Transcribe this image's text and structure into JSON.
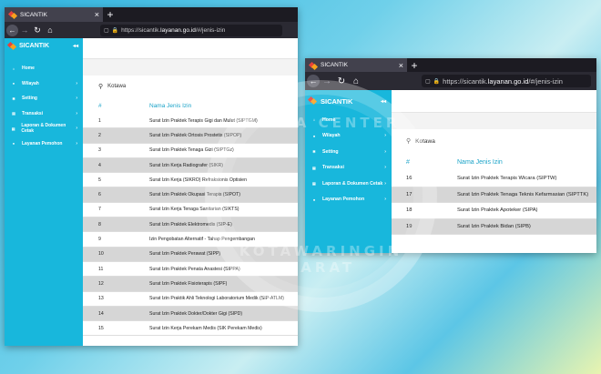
{
  "browser": {
    "tab_title": "SICANTIK",
    "close_glyph": "×",
    "newtab_glyph": "+",
    "back_glyph": "←",
    "forward_glyph": "→",
    "reload_glyph": "↻",
    "home_glyph": "⌂",
    "url_prefix": "https://sicantik.",
    "url_host": "layanan.go.id",
    "url_suffix": "/#/jenis-izin"
  },
  "sidebar": {
    "brand": "SICANTIK",
    "toggle": "◂◂",
    "items": [
      {
        "label": "Home",
        "icon": "⌂",
        "arrow": ""
      },
      {
        "label": "Wilayah",
        "icon": "●",
        "arrow": "›"
      },
      {
        "label": "Setting",
        "icon": "✱",
        "arrow": "›"
      },
      {
        "label": "Transaksi",
        "icon": "▤",
        "arrow": "›"
      },
      {
        "label": "Laporan & Dokumen Cetak",
        "icon": "▤",
        "arrow": "›"
      },
      {
        "label": "Layanan Pemohon",
        "icon": "●",
        "arrow": "›"
      }
    ]
  },
  "search": {
    "icon": "search-icon",
    "value": "Kotawa"
  },
  "table": {
    "col_no": "#",
    "col_name": "Nama Jenis Izin"
  },
  "left_rows": [
    {
      "no": "1",
      "name": "Surat Izin Praktek Terapis Gigi dan Mulut (SIPTGM)"
    },
    {
      "no": "2",
      "name": "Surat Izin Praktek Ortosis Prostetis (SIPOP)"
    },
    {
      "no": "3",
      "name": "Surat Izin Praktek Tenaga Gizi (SIPTGz)"
    },
    {
      "no": "4",
      "name": "Surat Izin Kerja Radiografer (SIKR)"
    },
    {
      "no": "5",
      "name": "Surat Izin Kerja (SIKRO) Refraksionis Optisien"
    },
    {
      "no": "6",
      "name": "Surat Izin Praktek Okupasi Terapis (SIPOT)"
    },
    {
      "no": "7",
      "name": "Surat Izin Kerja Tenaga Sanitarian (SIKTS)"
    },
    {
      "no": "8",
      "name": "Surat Izin Praktek Elektromedis (SIP-E)"
    },
    {
      "no": "9",
      "name": "Izin Pengobatan Alternatif - Tahap Pengembangan"
    },
    {
      "no": "10",
      "name": "Surat Izin Praktek Perawat (SIPP)"
    },
    {
      "no": "11",
      "name": "Surat Izin Praktek Penata Anastesi (SIPPA)"
    },
    {
      "no": "12",
      "name": "Surat Izin Praktek Fisioterapis (SIPF)"
    },
    {
      "no": "13",
      "name": "Surat Izin Praktik Ahli Teknologi Laboratorium Medik (SIP-ATLM)"
    },
    {
      "no": "14",
      "name": "Surat Izin Praktek Dokter/Dokter Gigi (SIPD)"
    },
    {
      "no": "15",
      "name": "Surat Izin Kerja Perekam Medis (SIK Perekam Medis)"
    }
  ],
  "right_rows": [
    {
      "no": "16",
      "name": "Surat Izin Praktek Terapis Wicara (SIPTW)"
    },
    {
      "no": "17",
      "name": "Surat Izin Praktek Tenaga Teknis Kefarmasian (SIPTTK)"
    },
    {
      "no": "18",
      "name": "Surat Izin Praktek Apoteker (SIPA)"
    },
    {
      "no": "19",
      "name": "Surat Izin Praktek Bidan (SIPB)"
    }
  ],
  "watermark": {
    "top": "MEDIA CENTER",
    "bottom": "KOTAWARINGIN BARAT"
  },
  "colors": {
    "sidebar": "#18b7dc",
    "header_text": "#1aa3c8",
    "row_shade": "#d6d6d6"
  }
}
